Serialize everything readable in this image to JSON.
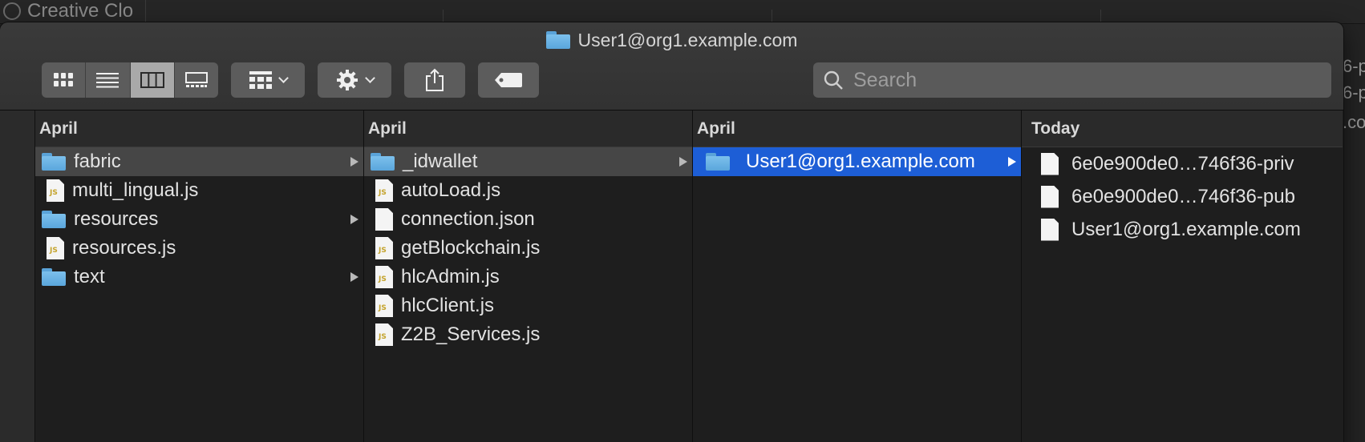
{
  "background": {
    "app_name": "Creative Clo",
    "right_fragments": [
      "6-p",
      "6-p",
      ".co"
    ]
  },
  "window": {
    "title": "User1@org1.example.com"
  },
  "toolbar": {
    "view_modes": [
      "icon-view",
      "list-view",
      "column-view",
      "gallery-view"
    ],
    "active_view": "column-view",
    "search_placeholder": "Search"
  },
  "columns": [
    {
      "header": "April",
      "items": [
        {
          "name": "fabric",
          "type": "folder",
          "selected": true,
          "has_children": true
        },
        {
          "name": "multi_lingual.js",
          "type": "js"
        },
        {
          "name": "resources",
          "type": "folder",
          "has_children": true
        },
        {
          "name": "resources.js",
          "type": "js"
        },
        {
          "name": "text",
          "type": "folder",
          "has_children": true
        }
      ]
    },
    {
      "header": "April",
      "items": [
        {
          "name": "_idwallet",
          "type": "folder",
          "selected": true,
          "has_children": true
        },
        {
          "name": "autoLoad.js",
          "type": "js"
        },
        {
          "name": "connection.json",
          "type": "doc"
        },
        {
          "name": "getBlockchain.js",
          "type": "js"
        },
        {
          "name": "hlcAdmin.js",
          "type": "js"
        },
        {
          "name": "hlcClient.js",
          "type": "js"
        },
        {
          "name": "Z2B_Services.js",
          "type": "js"
        }
      ]
    },
    {
      "header": "April",
      "items": [
        {
          "name": "User1@org1.example.com",
          "type": "folder",
          "selected_active": true,
          "has_children": true
        }
      ]
    },
    {
      "header": "Today",
      "items": [
        {
          "name": "6e0e900de0…746f36-priv",
          "type": "doc"
        },
        {
          "name": "6e0e900de0…746f36-pub",
          "type": "doc"
        },
        {
          "name": "User1@org1.example.com",
          "type": "doc"
        }
      ]
    }
  ],
  "colors": {
    "selection_active": "#1d5ed6",
    "selection_inactive": "#464646",
    "folder": "#6fb6e6"
  }
}
